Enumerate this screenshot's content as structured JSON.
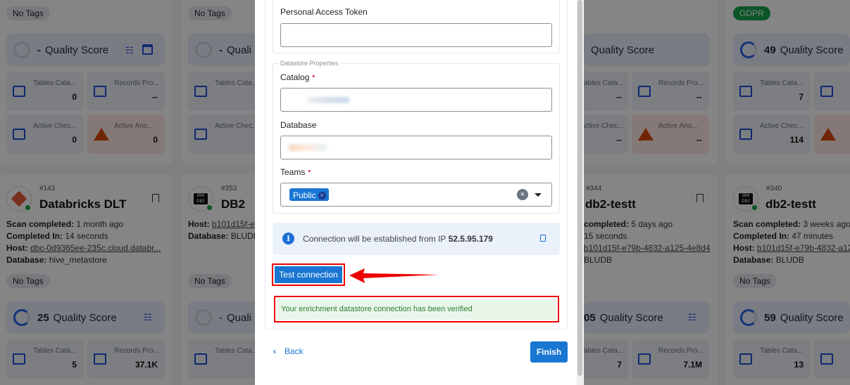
{
  "background": {
    "tags": {
      "no_tags": "No Tags",
      "gdpr": "GDPR"
    },
    "quality_label": "Quality Score",
    "quality_short": "Quali",
    "stat_labels": {
      "tables": "Tables Cata...",
      "records": "Records Pro...",
      "checks": "Active Chec...",
      "anomalies": "Active Ano..."
    },
    "top_cards": [
      {
        "score": "-",
        "tables": "0",
        "records": "--",
        "checks": "0",
        "anomalies": "0"
      },
      {
        "score": "-",
        "tables": "-",
        "records": "--",
        "checks": "-",
        "anomalies": "--"
      },
      {
        "score": "-",
        "tables": "--",
        "records": "--",
        "checks": "--",
        "anomalies": "--"
      },
      {
        "score": "49",
        "tables": "7",
        "records": "--",
        "checks": "114",
        "anomalies": "--"
      }
    ],
    "datastores": [
      {
        "number": "#143",
        "name": "Databricks DLT",
        "scan_label": "Scan completed:",
        "scan_value": "1 month ago",
        "completed_label": "Completed In:",
        "completed_value": "14 seconds",
        "host_label": "Host:",
        "host_value": "dbc-0d9365ee-235c.cloud.databr...",
        "db_label": "Database:",
        "db_value": "hive_metastore",
        "score": "25",
        "tables": "5",
        "records": "37.1K"
      },
      {
        "number": "#353",
        "name": "DB2",
        "host_label": "Host:",
        "host_value": "b101d15f-e7",
        "db_label": "Database:",
        "db_value": "BLUDB"
      },
      {
        "number": "#344",
        "name": "db2-testt",
        "scan_value_tail": "completed:",
        "scan_value": "5 days ago",
        "completed_value": "15 seconds",
        "host_value": "b101d15f-e79b-4832-a125-4e8d4...",
        "db_value": "BLUDB",
        "score": "05",
        "tables": "7",
        "records": "7.1M"
      },
      {
        "number": "#340",
        "name": "db2-testt",
        "scan_label": "Scan completed:",
        "scan_value": "3 weeks ago",
        "completed_label": "Completed In:",
        "completed_value": "47 minutes",
        "host_label": "Host:",
        "host_value": "b101d15f-e79b-4832-a125",
        "db_label": "Database:",
        "db_value": "BLUDB",
        "score": "59",
        "tables": "13"
      }
    ]
  },
  "modal": {
    "pat_label": "Personal Access Token",
    "pat_value": "",
    "properties_legend": "Datastore Properties",
    "catalog_label": "Catalog",
    "database_label": "Database",
    "teams_label": "Teams",
    "team_chip": "Public",
    "info_text": "Connection will be established from IP",
    "info_ip": "52.5.95.179",
    "test_button": "Test connection",
    "verified_message": "Your enrichment datastore connection has been verified",
    "back_label": "Back",
    "finish_label": "Finish"
  }
}
